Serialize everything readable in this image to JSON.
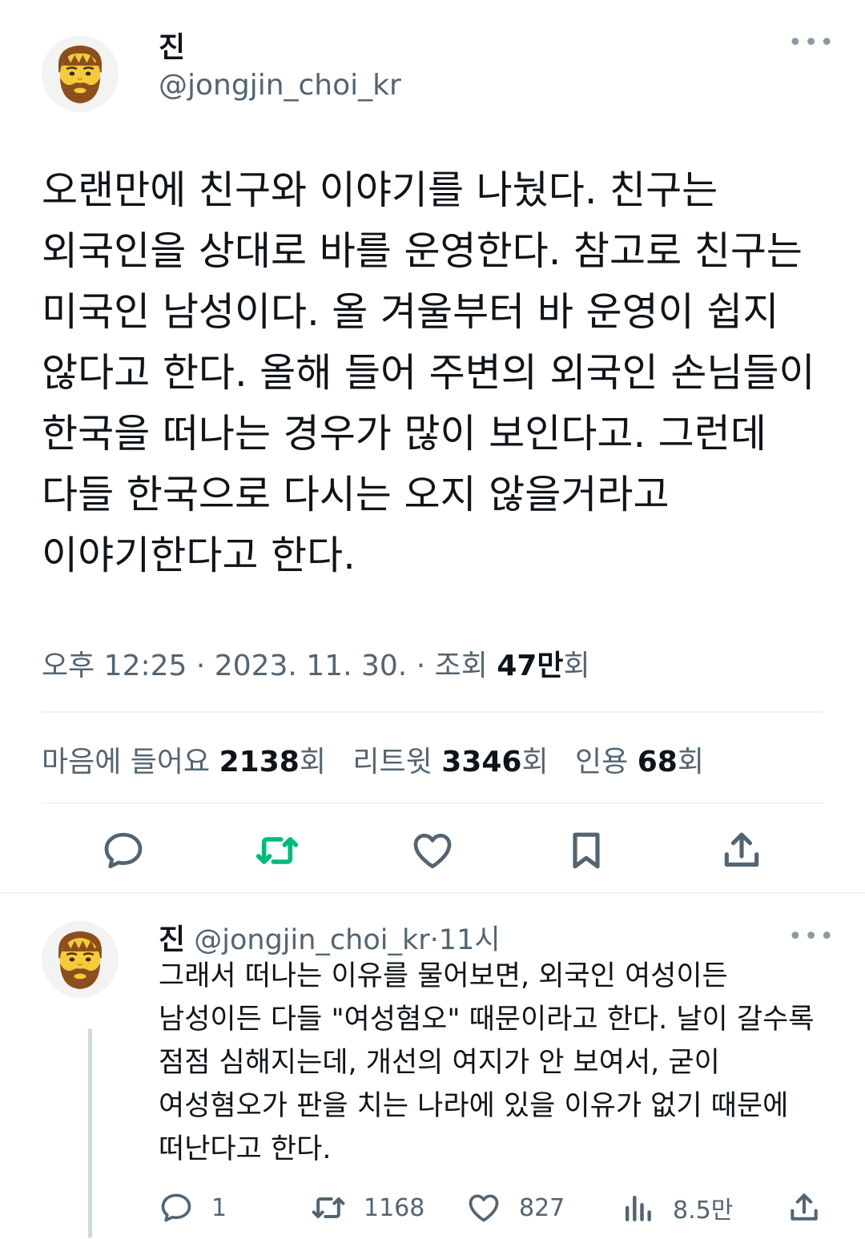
{
  "tweet": {
    "author": {
      "name": "진",
      "handle": "@jongjin_choi_kr",
      "avatar_icon": "bearded-man-emoji-icon"
    },
    "more_icon": "more-horizontal-icon",
    "text": "오랜만에 친구와 이야기를 나눴다. 친구는 외국인을 상대로 바를 운영한다. 참고로 친구는 미국인 남성이다. 올 겨울부터 바 운영이 쉽지 않다고 한다. 올해 들어 주변의 외국인 손님들이 한국을 떠나는 경우가 많이 보인다고. 그런데 다들 한국으로 다시는 오지 않을거라고 이야기한다고 한다.",
    "meta": {
      "time": "오후 12:25",
      "date": "2023. 11. 30.",
      "views_label": "조회",
      "views_value": "47만",
      "views_suffix": "회",
      "separator": "·"
    },
    "stats": {
      "likes_label": "마음에 들어요",
      "likes_value": "2138",
      "retweets_label": "리트윗",
      "retweets_value": "3346",
      "quotes_label": "인용",
      "quotes_value": "68",
      "suffix": "회"
    },
    "actions": [
      "reply-icon",
      "retweet-icon",
      "like-icon",
      "bookmark-icon",
      "share-icon"
    ],
    "colors": {
      "retweet_active": "#00ba7c",
      "icon": "#536471"
    }
  },
  "reply": {
    "author": {
      "name": "진",
      "handle": "@jongjin_choi_kr",
      "time": "11시",
      "separator": "·",
      "avatar_icon": "bearded-man-emoji-icon"
    },
    "more_icon": "more-horizontal-icon",
    "text": "그래서 떠나는 이유를 물어보면, 외국인 여성이든 남성이든 다들 \"여성혐오\" 때문이라고 한다. 날이 갈수록 점점 심해지는데, 개선의 여지가 안 보여서, 굳이 여성혐오가 판을 치는 나라에 있을 이유가 없기 때문에 떠난다고 한다.",
    "actions": {
      "replies": "1",
      "retweets": "1168",
      "likes": "827",
      "views": "8.5만"
    }
  }
}
